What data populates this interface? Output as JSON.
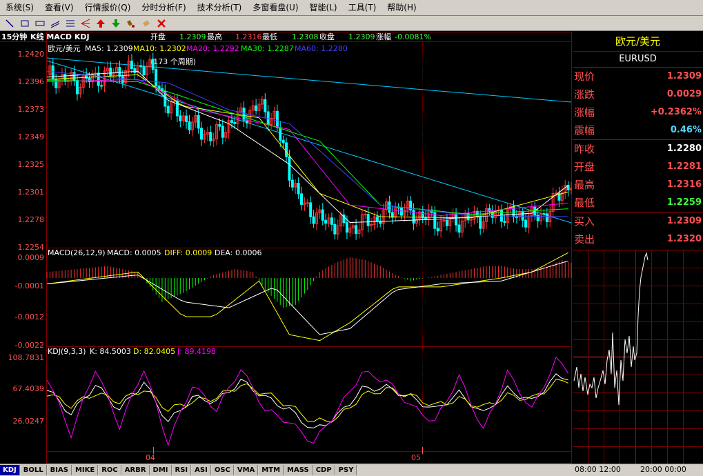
{
  "menu": [
    "系统(S)",
    "查看(V)",
    "行情报价(Q)",
    "分时分析(F)",
    "技术分析(T)",
    "多窗看盘(U)",
    "智能(L)",
    "工具(T)",
    "帮助(H)"
  ],
  "toolbar_icons": [
    "line-draw-icon",
    "rectangle-icon",
    "rectangle-alt-icon",
    "channel-icon",
    "fibonacci-icon",
    "fan-icon",
    "up-arrow-icon",
    "down-arrow-icon",
    "brush-icon",
    "eraser-icon",
    "delete-icon"
  ],
  "header": {
    "period": "15分钟",
    "indicators": "K线 MACD KDJ",
    "open_label": "开盘",
    "open_value": "1.2309",
    "high_label": "最高",
    "high_value": "1.2316",
    "low_label": "最低",
    "low_value": "1.2308",
    "close_label": "收盘",
    "close_value": "1.2309",
    "change_label": "涨幅",
    "change_value": "-0.0081%"
  },
  "legends": {
    "price": {
      "name": "欧元/美元",
      "ma5": "MA5: 1.2309",
      "ma10": "MA10: 1.2302",
      "ma20": "MA20: 1.2292",
      "ma30": "MA30: 1.2287",
      "ma60": "MA60: 1.2280"
    },
    "macd": {
      "name": "MACD(26,12,9)",
      "macd": "MACD: 0.0005",
      "diff": "DIFF: 0.0009",
      "dea": "DEA: 0.0006"
    },
    "kdj": {
      "name": "KDJ(9,3,3)",
      "k": "K: 84.5003",
      "d": "D: 82.0405",
      "j": "J: 89.4198"
    }
  },
  "annotation": "(173 个周期)",
  "axis": {
    "price_ticks": [
      "1.2420",
      "1.2396",
      "1.2373",
      "1.2349",
      "1.2325",
      "1.2301",
      "1.2278",
      "1.2254"
    ],
    "macd_ticks": [
      "0.0009",
      "-0.0001",
      "-0.0012",
      "-0.0022"
    ],
    "kdj_ticks": [
      "108.7831",
      "67.4039",
      "26.0247"
    ],
    "date_labels": [
      "04",
      "05"
    ]
  },
  "quote": {
    "title": "欧元/美元",
    "symbol": "EURUSD",
    "rows": [
      {
        "label": "现价",
        "value": "1.2309",
        "color": "#ff5050"
      },
      {
        "label": "涨跌",
        "value": "0.0029",
        "color": "#ff5050"
      },
      {
        "label": "涨幅",
        "value": "+0.2362%",
        "color": "#ff5050"
      },
      {
        "label": "震幅",
        "value": "0.46%",
        "color": "#50d8ff"
      },
      {
        "label": "昨收",
        "value": "1.2280",
        "color": "#ffffff"
      },
      {
        "label": "开盘",
        "value": "1.2281",
        "color": "#ff5050"
      },
      {
        "label": "最高",
        "value": "1.2316",
        "color": "#ff5050"
      },
      {
        "label": "最低",
        "value": "1.2259",
        "color": "#40ff40"
      },
      {
        "label": "买入",
        "value": "1.2309",
        "color": "#ff5050"
      },
      {
        "label": "卖出",
        "value": "1.2320",
        "color": "#ff5050"
      }
    ]
  },
  "tick_axis": {
    "t1": "08:00",
    "t2": "12:00",
    "t3": "20:00",
    "t4": "00:00"
  },
  "tabs": [
    "KDJ",
    "BOLL",
    "BIAS",
    "MIKE",
    "ROC",
    "ARBR",
    "DMI",
    "RSI",
    "ASI",
    "OSC",
    "VMA",
    "MTM",
    "MASS",
    "CDP",
    "PSY"
  ],
  "colors": {
    "up": "#ff3232",
    "down": "#00ffff",
    "ma5": "#ffffff",
    "ma10": "#ffff00",
    "ma20": "#ff00ff",
    "ma30": "#00ff00",
    "ma60": "#4040ff",
    "grid": "#800000",
    "axis_text": "#ff5050"
  },
  "chart_data": [
    {
      "type": "line",
      "title": "欧元/美元 15分钟",
      "x_range": [
        0,
        173
      ],
      "ylim": [
        1.2254,
        1.242
      ],
      "series": [
        {
          "name": "欧元/美元",
          "x": [
            0,
            10,
            20,
            30,
            33,
            40,
            50,
            55,
            60,
            70,
            75,
            80,
            83,
            90,
            100,
            110,
            115,
            120,
            125,
            130,
            140,
            150,
            160,
            165,
            170,
            173
          ],
          "values": [
            1.2402,
            1.2395,
            1.2402,
            1.2407,
            1.2412,
            1.2375,
            1.2355,
            1.2348,
            1.236,
            1.2375,
            1.2365,
            1.232,
            1.2295,
            1.2278,
            1.227,
            1.228,
            1.2288,
            1.2283,
            1.228,
            1.2274,
            1.2278,
            1.2283,
            1.2279,
            1.2283,
            1.2303,
            1.2309
          ]
        },
        {
          "name": "MA5",
          "x": [
            0,
            30,
            40,
            60,
            80,
            100,
            130,
            160,
            173
          ],
          "values": [
            1.24,
            1.2405,
            1.238,
            1.236,
            1.2325,
            1.2275,
            1.2278,
            1.2283,
            1.2309
          ]
        },
        {
          "name": "MA10",
          "x": [
            0,
            30,
            45,
            70,
            90,
            110,
            140,
            173
          ],
          "values": [
            1.2398,
            1.2402,
            1.2375,
            1.2365,
            1.23,
            1.228,
            1.2279,
            1.2302
          ]
        },
        {
          "name": "MA20",
          "x": [
            0,
            30,
            50,
            80,
            100,
            130,
            173
          ],
          "values": [
            1.2396,
            1.2398,
            1.2372,
            1.2355,
            1.229,
            1.2281,
            1.2292
          ]
        },
        {
          "name": "MA30",
          "x": [
            0,
            30,
            60,
            90,
            110,
            140,
            173
          ],
          "values": [
            1.2397,
            1.2396,
            1.237,
            1.2345,
            1.229,
            1.2282,
            1.2287
          ]
        },
        {
          "name": "MA60",
          "x": [
            0,
            40,
            60,
            80,
            110,
            140,
            173
          ],
          "values": [
            1.2405,
            1.2395,
            1.2372,
            1.236,
            1.229,
            1.2281,
            1.228
          ]
        }
      ]
    },
    {
      "type": "bar",
      "title": "MACD(26,12,9)",
      "ylim": [
        -0.0022,
        0.0009
      ],
      "series": [
        {
          "name": "MACD",
          "x": [
            0,
            10,
            20,
            30,
            38,
            45,
            55,
            62,
            68,
            72,
            78,
            82,
            86,
            90,
            95,
            100,
            105,
            110,
            115,
            120,
            125,
            130,
            135,
            140,
            145,
            150,
            155,
            160,
            165,
            170,
            173
          ],
          "values": [
            0.0002,
            0.0003,
            0.0004,
            0.0002,
            -0.0008,
            -0.0005,
            0.0001,
            0.0003,
            0.0002,
            -0.0004,
            -0.001,
            -0.0009,
            -0.0004,
            0.0002,
            0.0005,
            0.0007,
            0.0006,
            0.0004,
            0.0001,
            -0.0001,
            0.0,
            0.0001,
            0.0002,
            0.0003,
            0.0004,
            0.0004,
            0.0003,
            0.0003,
            0.0004,
            0.0006,
            0.0005
          ]
        },
        {
          "name": "DIFF",
          "x": [
            0,
            30,
            45,
            55,
            70,
            80,
            90,
            100,
            115,
            130,
            150,
            160,
            173
          ],
          "values": [
            -0.0002,
            0.0002,
            -0.0013,
            -0.0013,
            -0.0001,
            -0.0019,
            -0.0021,
            -0.0015,
            -0.0003,
            -0.0003,
            0.0,
            0.0002,
            0.0009
          ]
        },
        {
          "name": "DEA",
          "x": [
            0,
            30,
            45,
            60,
            75,
            90,
            100,
            115,
            130,
            150,
            173
          ],
          "values": [
            -0.0002,
            0.0001,
            -0.0008,
            -0.001,
            -0.0003,
            -0.0019,
            -0.0017,
            -0.0004,
            -0.0002,
            -0.0001,
            0.0006
          ]
        }
      ]
    },
    {
      "type": "line",
      "title": "KDJ(9,3,3)",
      "ylim": [
        0,
        110
      ],
      "series": [
        {
          "name": "K",
          "x": [
            0,
            8,
            16,
            24,
            32,
            40,
            48,
            56,
            64,
            72,
            80,
            88,
            96,
            104,
            112,
            120,
            128,
            136,
            144,
            152,
            160,
            168,
            173
          ],
          "values": [
            70,
            40,
            75,
            45,
            78,
            30,
            60,
            55,
            80,
            60,
            45,
            20,
            38,
            70,
            72,
            60,
            45,
            65,
            40,
            70,
            55,
            85,
            84.5
          ]
        },
        {
          "name": "D",
          "x": [
            0,
            8,
            16,
            24,
            32,
            40,
            48,
            56,
            64,
            72,
            80,
            88,
            96,
            104,
            112,
            120,
            128,
            136,
            144,
            152,
            160,
            168,
            173
          ],
          "values": [
            65,
            50,
            65,
            55,
            70,
            45,
            55,
            60,
            75,
            65,
            50,
            30,
            35,
            62,
            70,
            62,
            50,
            58,
            48,
            62,
            58,
            78,
            82.0
          ]
        },
        {
          "name": "J",
          "x": [
            0,
            8,
            16,
            24,
            32,
            40,
            48,
            56,
            64,
            72,
            80,
            88,
            96,
            104,
            112,
            120,
            128,
            136,
            144,
            152,
            160,
            168,
            173
          ],
          "values": [
            85,
            15,
            95,
            25,
            95,
            5,
            75,
            45,
            95,
            45,
            30,
            5,
            45,
            90,
            80,
            50,
            30,
            85,
            20,
            90,
            45,
            105,
            89.4
          ]
        }
      ]
    }
  ]
}
